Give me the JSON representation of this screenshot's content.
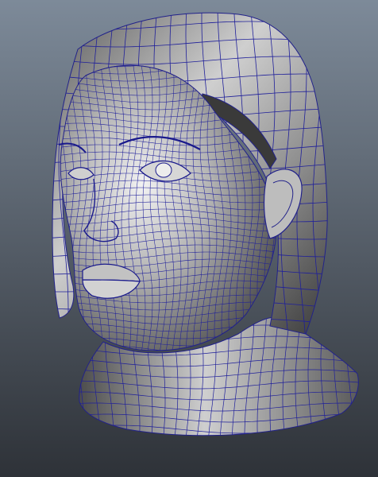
{
  "viewport": {
    "background_top": "#7d8a99",
    "background_bottom": "#2e3238"
  },
  "model": {
    "subject": "female-head-bust-wireframe",
    "shading_color": "#9a9a9a",
    "wireframe_color": "#1f1f9a",
    "highlight_color": "#e6e6e6",
    "shadow_color": "#3c3c3c"
  }
}
